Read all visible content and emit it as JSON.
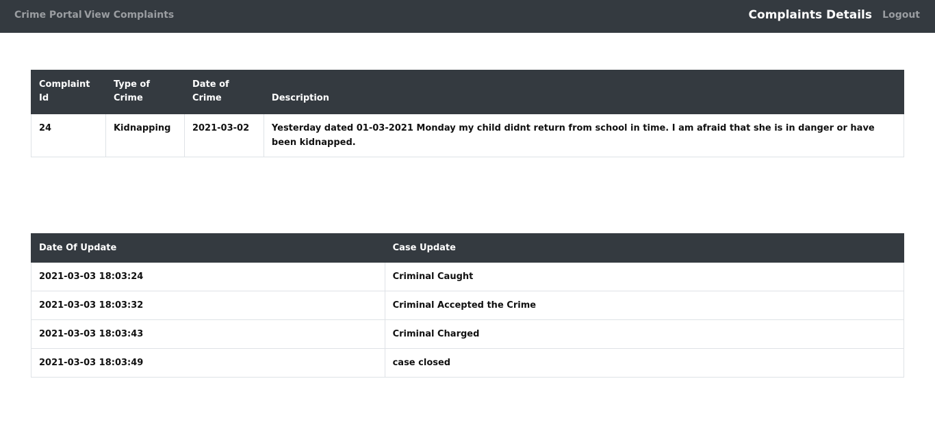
{
  "navbar": {
    "brand": "Crime Portal",
    "view_complaints": "View Complaints",
    "page_heading": "Complaints Details",
    "logout": "Logout"
  },
  "complaint_table": {
    "headers": {
      "id": "Complaint Id",
      "type": "Type of Crime",
      "date": "Date of Crime",
      "description": "Description"
    },
    "row": {
      "id": "24",
      "type": "Kidnapping",
      "date": "2021-03-02",
      "description": "Yesterday dated 01-03-2021 Monday my child didnt return from school in time. I am afraid that she is in danger or have been kidnapped."
    }
  },
  "updates_table": {
    "headers": {
      "date": "Date Of Update",
      "update": "Case Update"
    },
    "rows": [
      {
        "date": "2021-03-03 18:03:24",
        "update": "Criminal Caught"
      },
      {
        "date": "2021-03-03 18:03:32",
        "update": "Criminal Accepted the Crime"
      },
      {
        "date": "2021-03-03 18:03:43",
        "update": "Criminal Charged"
      },
      {
        "date": "2021-03-03 18:03:49",
        "update": "case closed"
      }
    ]
  }
}
